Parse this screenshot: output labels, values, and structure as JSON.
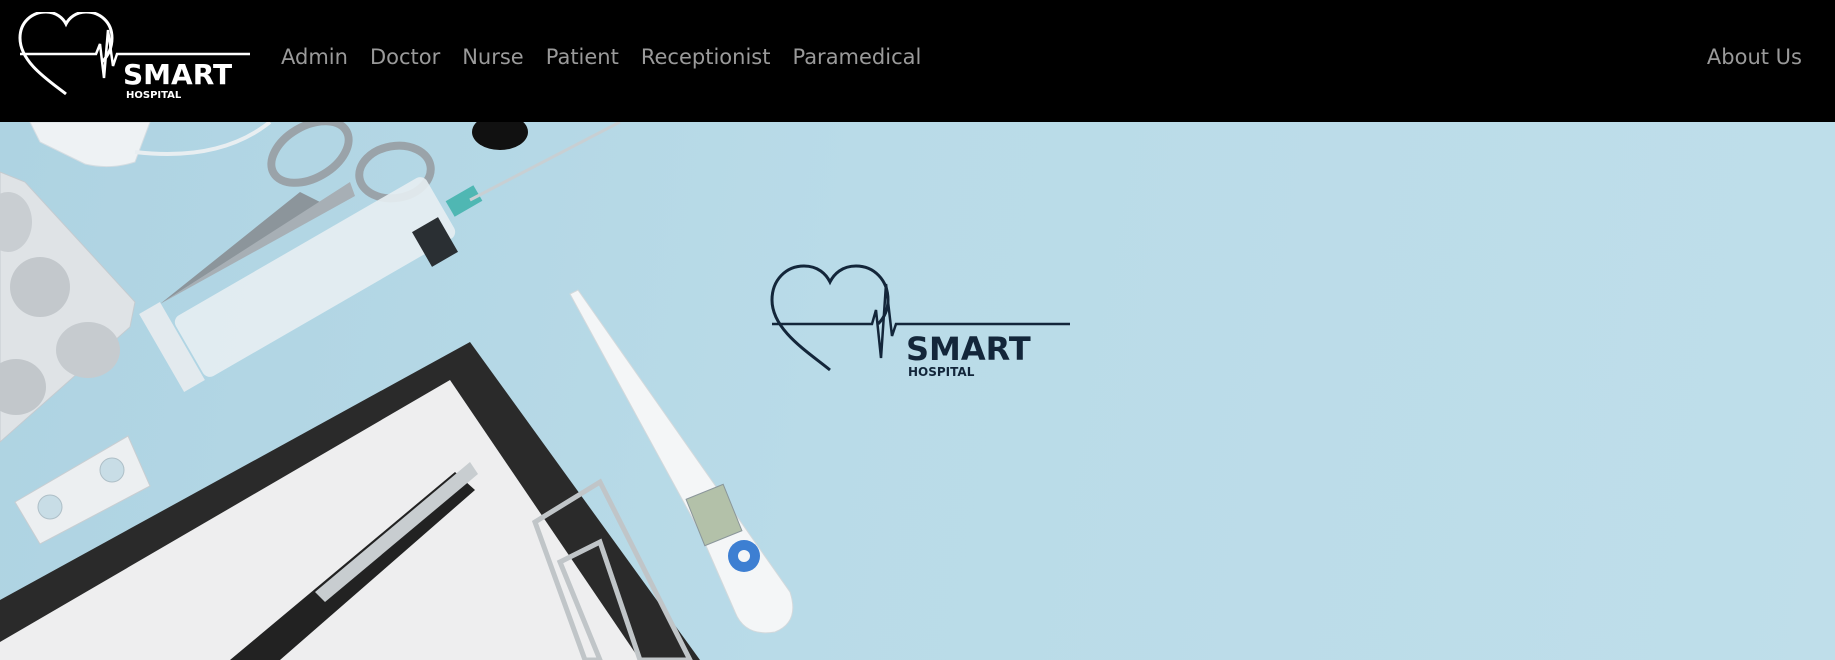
{
  "brand": {
    "name": "SMART",
    "subtitle": "HOSPITAL"
  },
  "nav": {
    "items": [
      {
        "label": "Admin"
      },
      {
        "label": "Doctor"
      },
      {
        "label": "Nurse"
      },
      {
        "label": "Patient"
      },
      {
        "label": "Receptionist"
      },
      {
        "label": "Paramedical"
      }
    ],
    "about": "About Us"
  },
  "hero": {
    "logo_name": "SMART",
    "logo_subtitle": "HOSPITAL",
    "background_color": "#b7d9e6",
    "logo_color": "#13263a"
  },
  "colors": {
    "navbar": "#000000",
    "nav_text": "#9a9a9a"
  }
}
